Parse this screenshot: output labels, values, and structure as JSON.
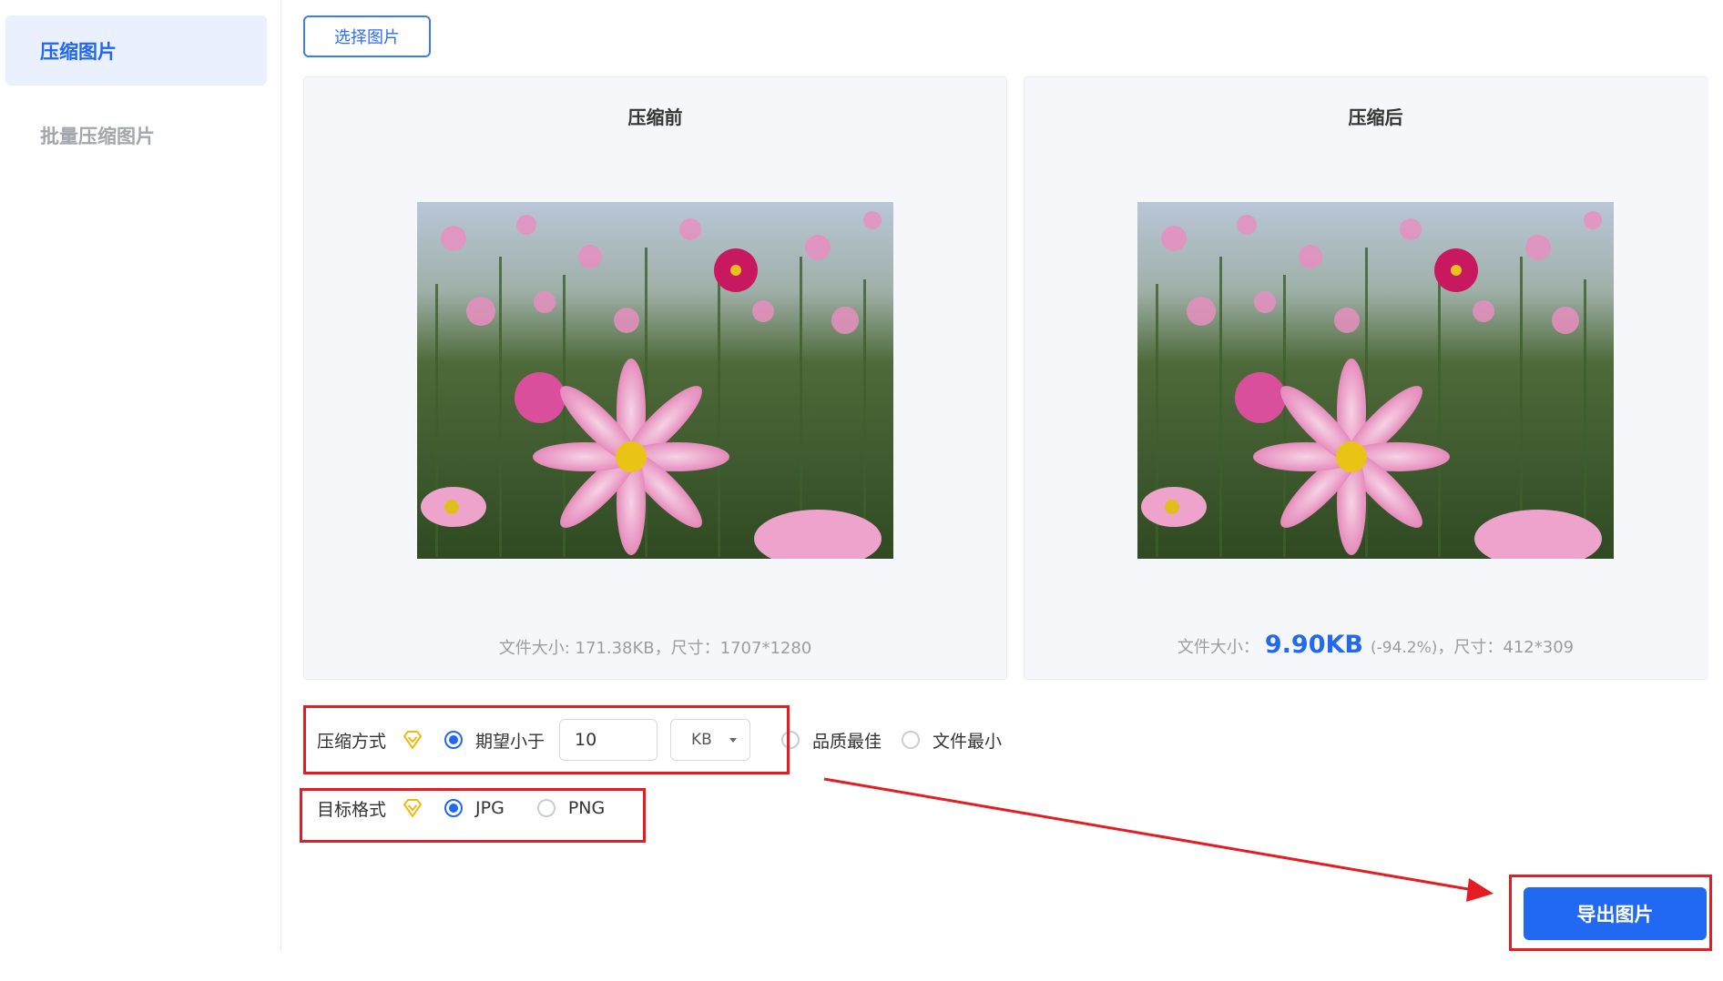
{
  "sidebar": {
    "items": [
      {
        "label": "压缩图片",
        "active": true
      },
      {
        "label": "批量压缩图片",
        "active": false
      }
    ]
  },
  "toolbar": {
    "select_label": "选择图片"
  },
  "before": {
    "title": "压缩前",
    "info_label": "文件大小",
    "info_text": ": 171.38KB，尺寸：1707*1280"
  },
  "after": {
    "title": "压缩后",
    "info_label": "文件大小：",
    "size_value": "9.90KB",
    "pct_text": "(-94.2%)",
    "dim_text": "，尺寸：412*309"
  },
  "compression": {
    "label": "压缩方式",
    "options": [
      "期望小于",
      "品质最佳",
      "文件最小"
    ],
    "selected": "期望小于",
    "target_value": "10",
    "unit": "KB"
  },
  "format": {
    "label": "目标格式",
    "options": [
      "JPG",
      "PNG"
    ],
    "selected": "JPG"
  },
  "export": {
    "label": "导出图片"
  },
  "colors": {
    "accent": "#2168f2",
    "highlight": "#e51c23",
    "vip": "#f0b90b"
  }
}
